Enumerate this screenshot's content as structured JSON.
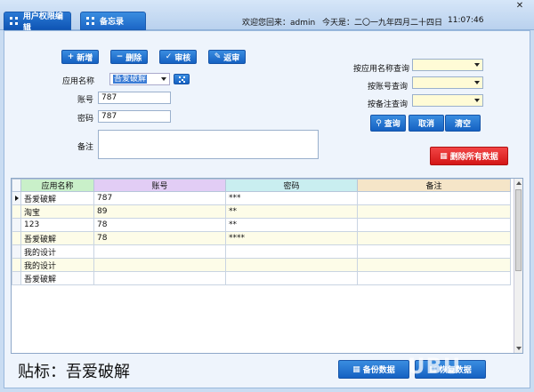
{
  "tabs": [
    {
      "label": "用户权限编辑",
      "active": true
    },
    {
      "label": "备忘录",
      "active": false
    }
  ],
  "header": {
    "welcome": "欢迎您回来：admin",
    "date": "今天是：二〇一九年四月二十四日",
    "time": "11:07:46",
    "close_glyph": "✕"
  },
  "toolbar": {
    "add": "新增",
    "delete": "删除",
    "audit": "审核",
    "unaudit": "返审"
  },
  "form": {
    "app_label": "应用名称",
    "app_value": "吾爱破解",
    "account_label": "账号",
    "account_value": "787",
    "password_label": "密码",
    "password_value": "787",
    "remark_label": "备注",
    "remark_value": ""
  },
  "search": {
    "by_app": "按应用名称查询",
    "by_account": "按账号查询",
    "by_remark": "按备注查询",
    "query": "查询",
    "cancel": "取消",
    "clear": "清空"
  },
  "delete_all": "删除所有数据",
  "table": {
    "columns": [
      "应用名称",
      "账号",
      "密码",
      "备注"
    ],
    "column_colors": [
      "#c9f0c9",
      "#e2cdf5",
      "#c9eef0",
      "#f5e5c8"
    ],
    "rows": [
      [
        "吾爱破解",
        "787",
        "***",
        ""
      ],
      [
        "淘宝",
        "89",
        "**",
        ""
      ],
      [
        "123",
        "78",
        "**",
        ""
      ],
      [
        "吾爱破解",
        "78",
        "****",
        ""
      ],
      [
        "我的设计",
        "",
        "",
        ""
      ],
      [
        "我的设计",
        "",
        "",
        ""
      ],
      [
        "吾爱破解",
        "",
        "",
        ""
      ]
    ]
  },
  "footer": {
    "text": "贴标：吾爱破解",
    "backup": "备份数据",
    "restore": "恢复数据",
    "watermark": "UBU"
  }
}
